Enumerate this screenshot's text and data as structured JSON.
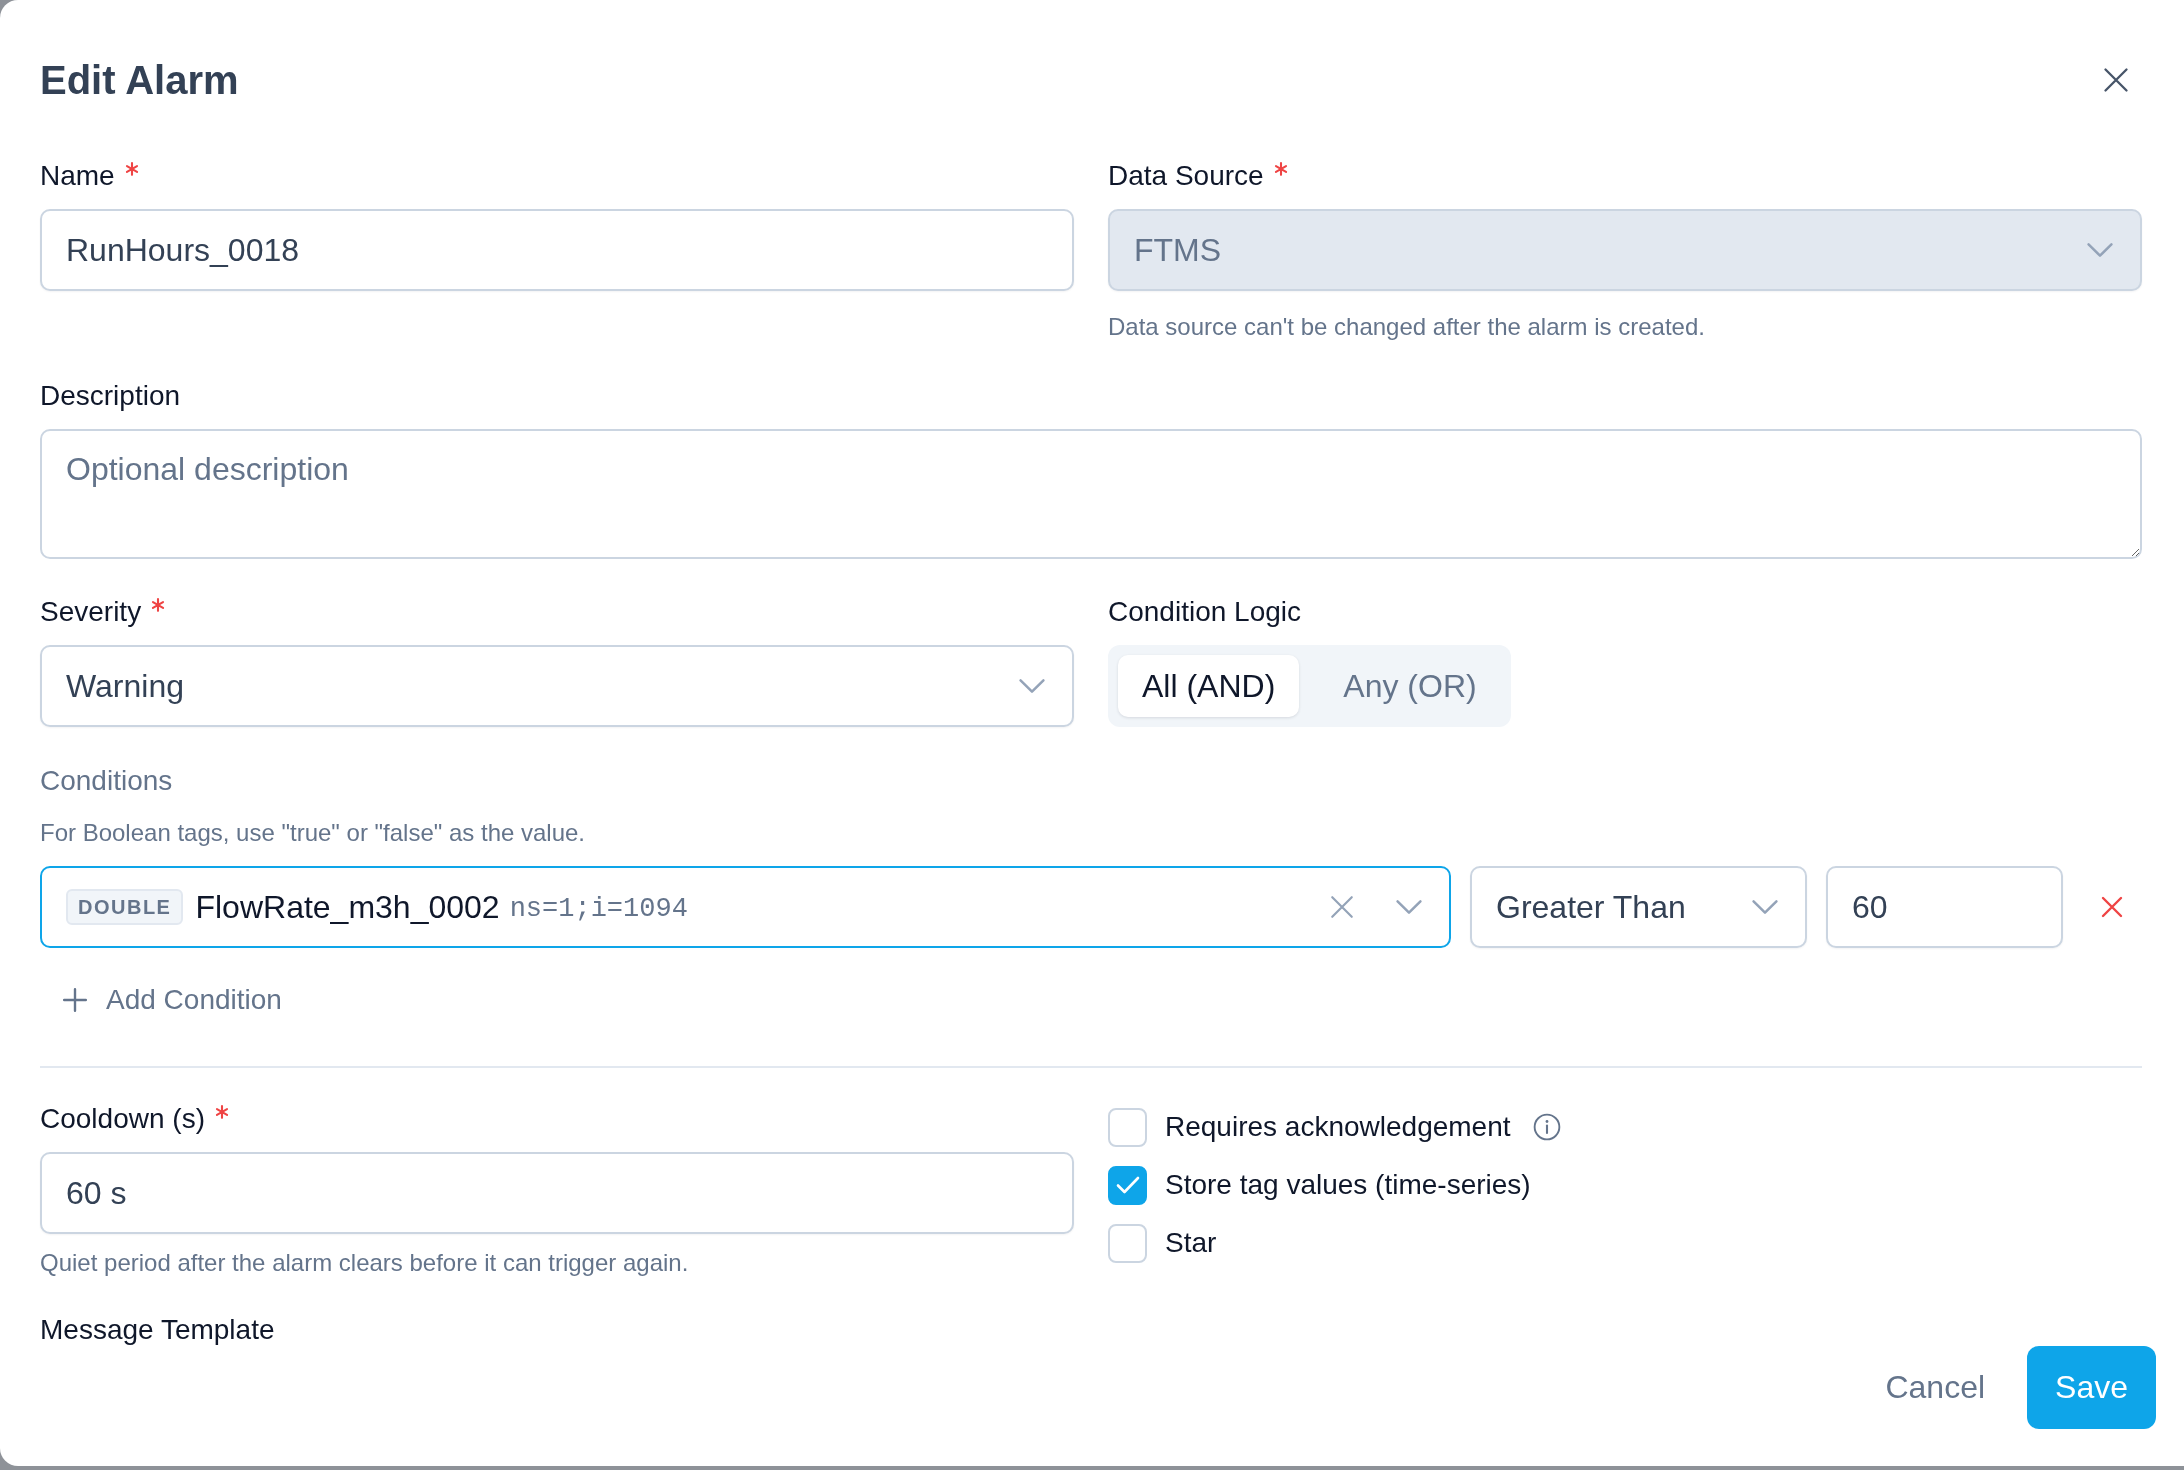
{
  "dialog": {
    "title": "Edit Alarm"
  },
  "fields": {
    "name": {
      "label": "Name",
      "required": true,
      "value": "RunHours_0018"
    },
    "data_source": {
      "label": "Data Source",
      "required": true,
      "value": "FTMS",
      "disabled": true,
      "hint": "Data source can't be changed after the alarm is created."
    },
    "description": {
      "label": "Description",
      "required": false,
      "placeholder": "Optional description"
    },
    "severity": {
      "label": "Severity",
      "required": true,
      "value": "Warning"
    },
    "condition_logic": {
      "label": "Condition Logic",
      "required": false,
      "options": [
        {
          "label": "All (AND)",
          "selected": true
        },
        {
          "label": "Any (OR)",
          "selected": false
        }
      ]
    }
  },
  "conditions": {
    "heading": "Conditions",
    "hint": "For Boolean tags, use \"true\" or \"false\" as the value.",
    "rows": [
      {
        "tag_type": "DOUBLE",
        "tag_name": "FlowRate_m3h_0002",
        "tag_id": "ns=1;i=1094",
        "focused": true,
        "operator": "Greater Than",
        "value": "60"
      }
    ],
    "add_label": "Add Condition"
  },
  "cooldown": {
    "label": "Cooldown (s)",
    "required": true,
    "value": "60 s",
    "hint": "Quiet period after the alarm clears before it can trigger again."
  },
  "options": [
    {
      "label": "Requires acknowledgement",
      "checked": false,
      "info": true
    },
    {
      "label": "Store tag values (time-series)",
      "checked": true,
      "info": false
    },
    {
      "label": "Star",
      "checked": false,
      "info": false
    }
  ],
  "message_template": {
    "label": "Message Template",
    "required": false
  },
  "footer": {
    "buttons": [
      {
        "kind": "secondary",
        "label": "Cancel"
      },
      {
        "kind": "primary",
        "label": "Save"
      }
    ]
  }
}
